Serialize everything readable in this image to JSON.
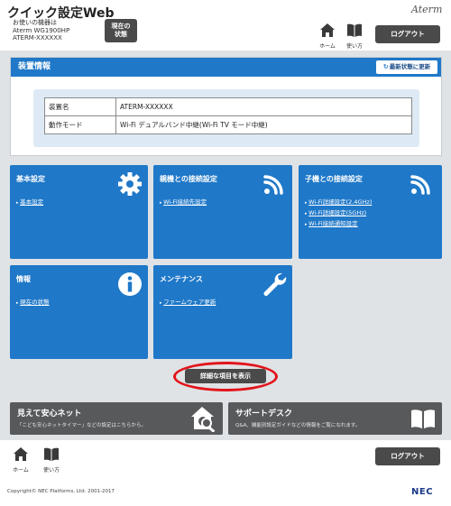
{
  "header": {
    "app_title": "クイック設定Web",
    "device_lines": [
      "お使いの機器は",
      "Aterm WG1900HP",
      "ATERM-XXXXXX"
    ],
    "status_button": [
      "現在の",
      "状態"
    ],
    "logo": "Aterm",
    "home_label": "ホーム",
    "manual_label": "使い方",
    "logout_label": "ログアウト"
  },
  "device_panel": {
    "title": "装置情報",
    "refresh_label": "最新状態に更新",
    "rows": [
      {
        "key": "装置名",
        "value": "ATERM-XXXXXX"
      },
      {
        "key": "動作モード",
        "value": "Wi-Fi デュアルバンド中継(Wi-Fi TV モード中継)"
      }
    ]
  },
  "tiles": {
    "basic": {
      "title": "基本設定",
      "links": [
        "基本設定"
      ],
      "icon": "gear-icon"
    },
    "parent": {
      "title": "親機との接続設定",
      "links": [
        "Wi-Fi接続先設定"
      ],
      "icon": "wifi-icon"
    },
    "child": {
      "title": "子機との接続設定",
      "links": [
        "Wi-Fi詳細設定(2.4GHz)",
        "Wi-Fi詳細設定(5GHz)",
        "Wi-Fi接続通知設定"
      ],
      "icon": "wifi-icon"
    },
    "info": {
      "title": "情報",
      "links": [
        "現在の状態"
      ],
      "icon": "info-icon"
    },
    "maint": {
      "title": "メンテナンス",
      "links": [
        "ファームウェア更新"
      ],
      "icon": "wrench-icon"
    }
  },
  "detail_button": "詳細な項目を表示",
  "banners": {
    "mimamori": {
      "title": "見えて安心ネット",
      "desc": "「こども安心ネットタイマー」などの設定はこちらから。",
      "icon": "house-search-icon"
    },
    "support": {
      "title": "サポートデスク",
      "desc": "Q&A、機能別設定ガイドなどの情報をご覧になれます。",
      "icon": "book-icon"
    }
  },
  "footer": {
    "home_label": "ホーム",
    "manual_label": "使い方",
    "logout_label": "ログアウト",
    "copyright": "Copyright© NEC Platforms, Ltd. 2001-2017",
    "brand": "NEC"
  },
  "colors": {
    "accent": "#1f78c8",
    "dark_button": "#4a4a4a",
    "highlight": "#e3141b",
    "banner": "#58595b"
  }
}
